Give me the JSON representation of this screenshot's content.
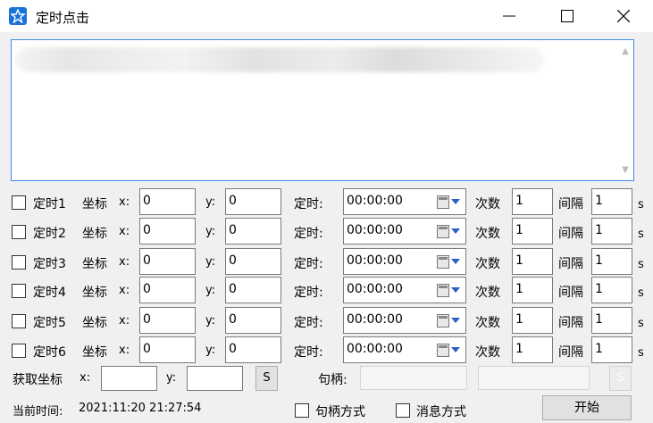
{
  "window": {
    "title": "定时点击",
    "app_icon": "star-icon",
    "controls": {
      "minimize": "minimize-icon",
      "maximize": "maximize-icon",
      "close": "close-icon"
    }
  },
  "log": {
    "blurred_line": "(blurred text)",
    "scroll_up": "^",
    "scroll_down": "v"
  },
  "timers": [
    {
      "label": "定时1",
      "coord_label": "坐标",
      "x_label": "x:",
      "x": "0",
      "y_label": "y:",
      "y": "0",
      "time_label": "定时:",
      "time": "00:00:00",
      "count_label": "次数",
      "count": "1",
      "interval_label": "间隔",
      "interval": "1",
      "unit": "s"
    },
    {
      "label": "定时2",
      "coord_label": "坐标",
      "x_label": "x:",
      "x": "0",
      "y_label": "y:",
      "y": "0",
      "time_label": "定时:",
      "time": "00:00:00",
      "count_label": "次数",
      "count": "1",
      "interval_label": "间隔",
      "interval": "1",
      "unit": "s"
    },
    {
      "label": "定时3",
      "coord_label": "坐标",
      "x_label": "x:",
      "x": "0",
      "y_label": "y:",
      "y": "0",
      "time_label": "定时:",
      "time": "00:00:00",
      "count_label": "次数",
      "count": "1",
      "interval_label": "间隔",
      "interval": "1",
      "unit": "s"
    },
    {
      "label": "定时4",
      "coord_label": "坐标",
      "x_label": "x:",
      "x": "0",
      "y_label": "y:",
      "y": "0",
      "time_label": "定时:",
      "time": "00:00:00",
      "count_label": "次数",
      "count": "1",
      "interval_label": "间隔",
      "interval": "1",
      "unit": "s"
    },
    {
      "label": "定时5",
      "coord_label": "坐标",
      "x_label": "x:",
      "x": "0",
      "y_label": "y:",
      "y": "0",
      "time_label": "定时:",
      "time": "00:00:00",
      "count_label": "次数",
      "count": "1",
      "interval_label": "间隔",
      "interval": "1",
      "unit": "s"
    },
    {
      "label": "定时6",
      "coord_label": "坐标",
      "x_label": "x:",
      "x": "0",
      "y_label": "y:",
      "y": "0",
      "time_label": "定时:",
      "time": "00:00:00",
      "count_label": "次数",
      "count": "1",
      "interval_label": "间隔",
      "interval": "1",
      "unit": "s"
    }
  ],
  "capture": {
    "label": "获取坐标",
    "x_label": "x:",
    "x": "",
    "y_label": "y:",
    "y": "",
    "s_button": "S",
    "handle_label": "句柄:",
    "handle": "",
    "handle_s_button": "S"
  },
  "footer": {
    "time_label": "当前时间:",
    "time": "2021:11:20 21:27:54",
    "handle_mode": "句柄方式",
    "message_mode": "消息方式",
    "start_button": "开始"
  }
}
